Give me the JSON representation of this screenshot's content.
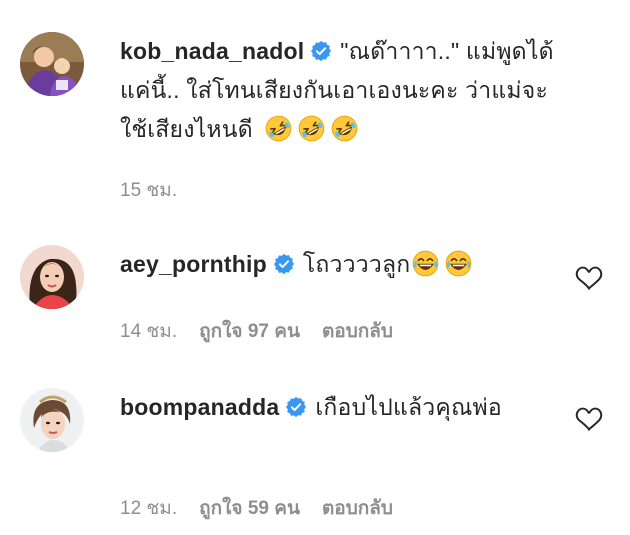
{
  "comments": [
    {
      "username": "kob_nada_nadol",
      "text": "\"ณด๊าาาา..\" แม่พูดได้แค่นี้.. ใส่โทนเสียงกันเอาเองนะคะ ว่าแม่จะใช้เสียงไหนดี",
      "emojis": [
        "rolling-on-floor-laughing",
        "rolling-on-floor-laughing",
        "rolling-on-floor-laughing"
      ],
      "time": "15 ชม.",
      "verified": true
    },
    {
      "username": "aey_pornthip",
      "text": "โถววววลูก",
      "emojis": [
        "tears-of-joy",
        "tears-of-joy"
      ],
      "time": "14 ชม.",
      "likes": "ถูกใจ 97 คน",
      "reply": "ตอบกลับ",
      "verified": true
    },
    {
      "username": "boompanadda",
      "text": "เกือบไปแล้วคุณพ่อ",
      "time": "12 ชม.",
      "likes": "ถูกใจ 59 คน",
      "reply": "ตอบกลับ",
      "verified": true
    }
  ],
  "colors": {
    "verified_blue": "#3897f0",
    "text": "#262626",
    "meta": "#8e8e8e",
    "emoji_yellow": "#FFC83D"
  }
}
